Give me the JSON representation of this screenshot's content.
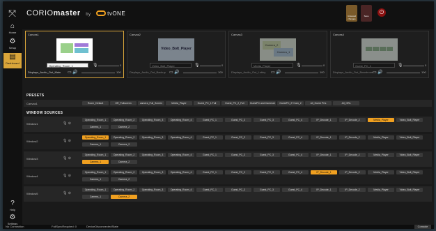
{
  "app": {
    "brand_main": "CORIO",
    "brand_bold": "master",
    "brand_by": "by",
    "brand_tv": "tvONE"
  },
  "toolbar": {
    "unsaved_label": "Unsaved changes",
    "save_label": "Save",
    "power_icon": "power-icon"
  },
  "sidebar": {
    "items": [
      {
        "label": "Home",
        "icon": "home-icon"
      },
      {
        "label": "Setup",
        "icon": "gear-icon"
      },
      {
        "label": "Dashboard",
        "icon": "dashboard-icon"
      }
    ],
    "bottom": [
      {
        "label": "Help",
        "icon": "help-icon"
      },
      {
        "label": "Settings",
        "icon": "gear-icon"
      }
    ]
  },
  "canvases": [
    {
      "title": "Canvas1",
      "source": "Operating_Room_1",
      "level": "0",
      "audio": "Displays_Audio_Out_Main",
      "audio_level": "100",
      "preview_text": ""
    },
    {
      "title": "Canvas2",
      "source": "Video_Bolt_Player",
      "level": "0",
      "audio": "Displays_Audio_Out_Backup",
      "audio_level": "100",
      "preview_text": "Video_Bolt_Player"
    },
    {
      "title": "Canvas3",
      "source": "Media_Player",
      "level": "0",
      "audio": "Displays_Audio_Out_Lobby",
      "audio_level": "100",
      "preview_text_1": "Camera_2",
      "preview_text_2": "Camera_1"
    },
    {
      "title": "Canvas4",
      "source": "Guest_PC_1",
      "level": "0",
      "audio": "Displays_Audio_Out_Boardroom",
      "audio_level": "100",
      "preview_text": ""
    }
  ],
  "presets": {
    "title": "PRESETS",
    "row_label": "Canvas1",
    "items": [
      "Room_Default",
      "OR_Fullscreen",
      "camera_Full_Screen",
      "Media_Player",
      "Guest_PC_1 Full",
      "Guest_PC_2_Full",
      "GuestPC and Camera1",
      "GuestPC_2+Cam_2",
      "All_Guest PCs",
      "All_ORs"
    ]
  },
  "window_sources": {
    "title": "WINDOW SOURCES",
    "sources": [
      "Operating_Room_1",
      "Operating_Room_2",
      "Operating_Room_3",
      "Operating_Room_4",
      "Guest_PC_1",
      "Guest_PC_2",
      "Guest_PC_3",
      "Guest_PC_4",
      "IP_Decode_1",
      "IP_Decode_2",
      "Media_Player",
      "Video_Bolt_Player"
    ],
    "cameras": [
      "Camera_1",
      "Camera_2"
    ],
    "windows": [
      {
        "label": "Window1",
        "active": "Media_Player"
      },
      {
        "label": "Window2",
        "active": "Operating_Room_1"
      },
      {
        "label": "Window3",
        "active": "Camera_1"
      },
      {
        "label": "Window4",
        "active": "IP_Decode_1"
      },
      {
        "label": "Window5",
        "active": "Camera_2"
      }
    ]
  },
  "status": {
    "connection": "No Connection",
    "sync": "FullSyncRequired: 0",
    "state": "DeviceDisconnectedState",
    "console": "Console"
  }
}
